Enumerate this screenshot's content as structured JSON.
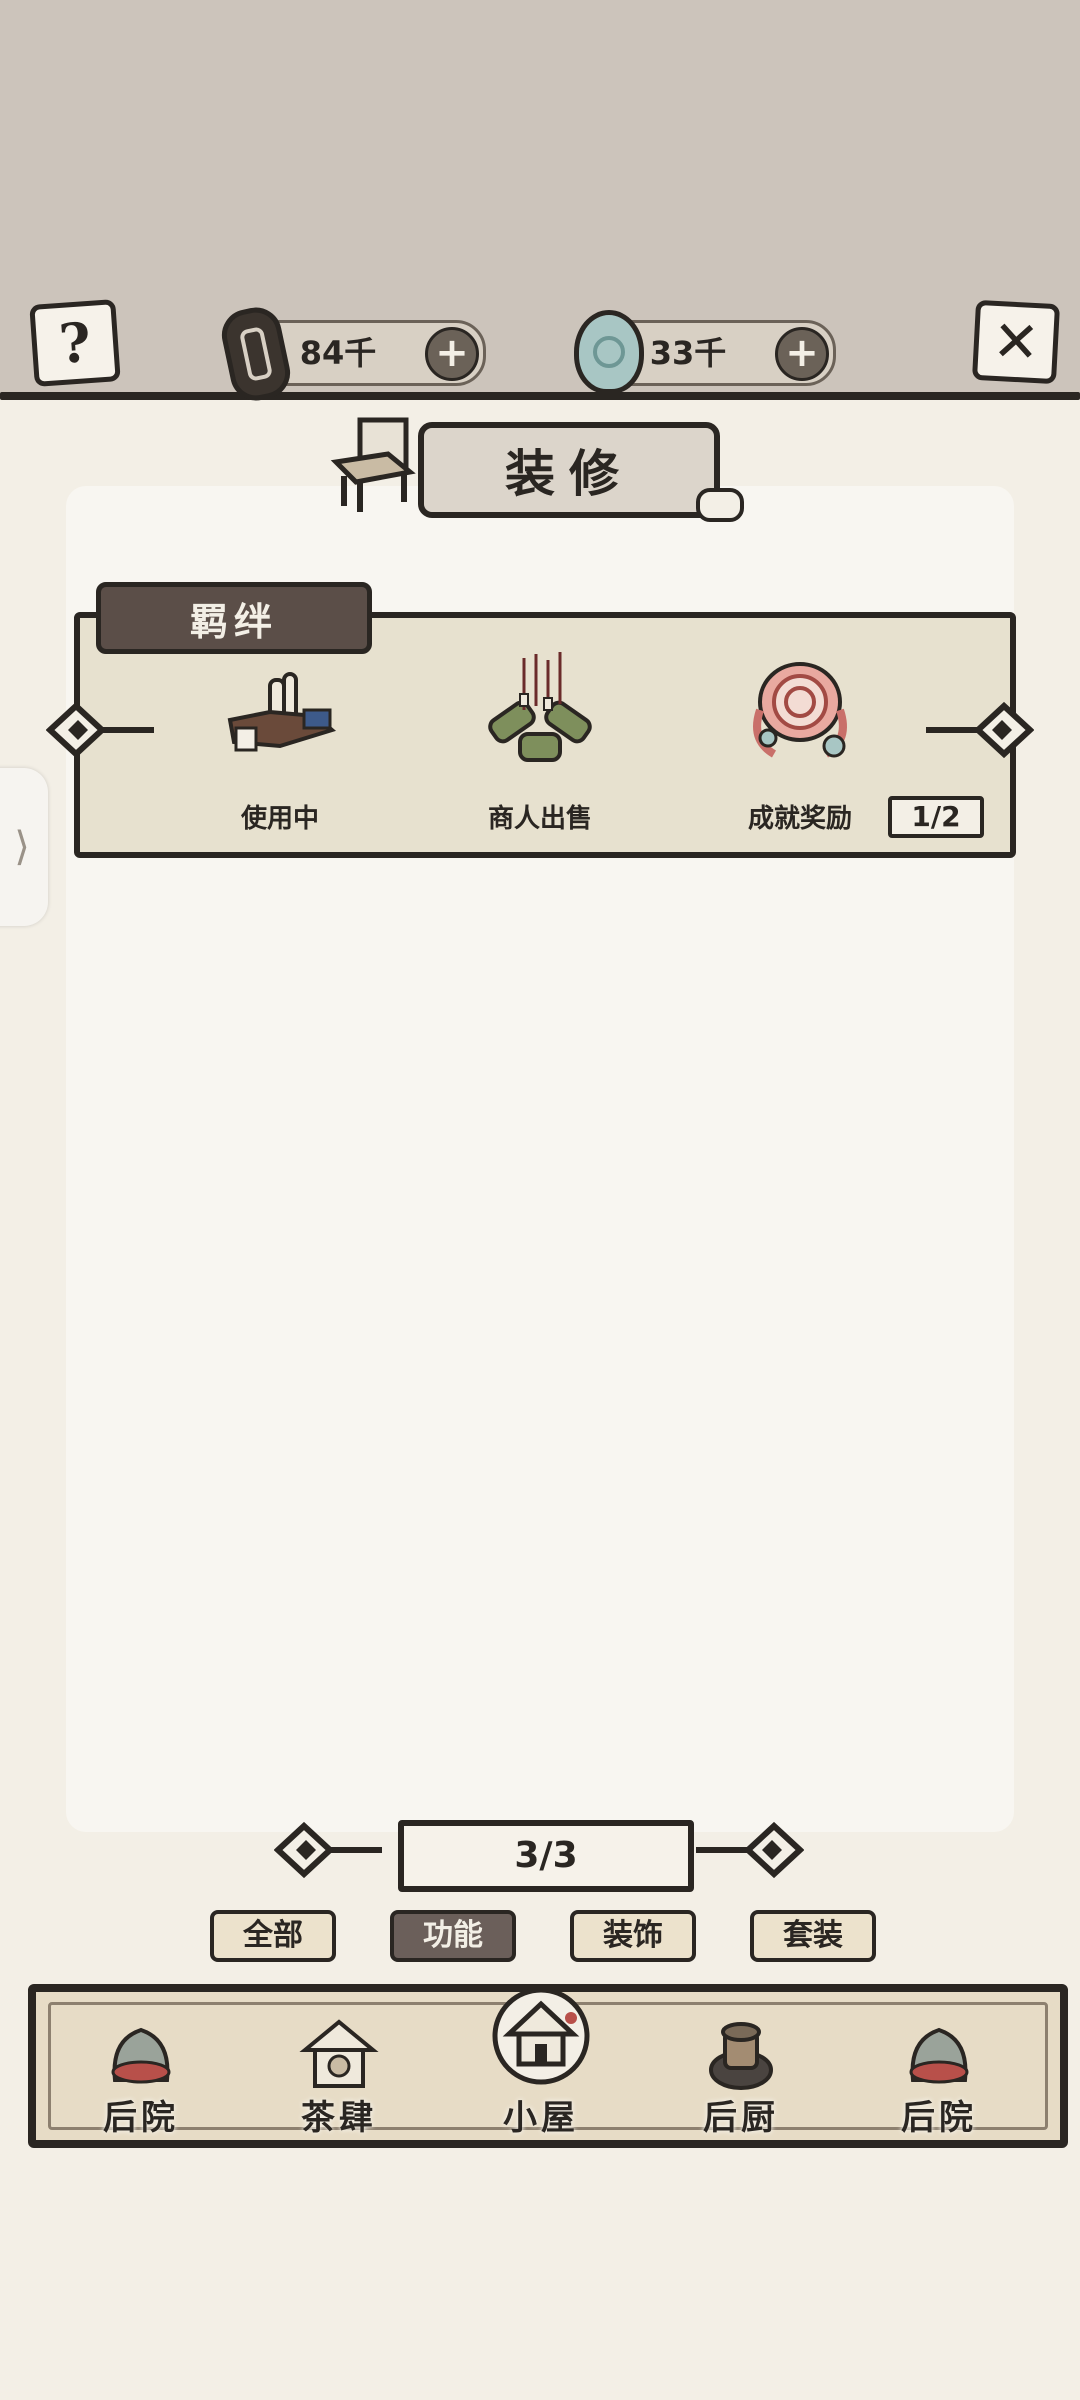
{
  "header": {
    "help_icon": "question-icon",
    "close_icon": "close-icon",
    "currencies": [
      {
        "icon": "coin-icon",
        "value": "84千",
        "plus": "+"
      },
      {
        "icon": "jade-icon",
        "value": "33千",
        "plus": "+"
      }
    ]
  },
  "title": "装修",
  "bond": {
    "tab_label": "羁绊",
    "items": [
      {
        "label": "使用中"
      },
      {
        "label": "商人出售"
      },
      {
        "label": "成就奖励"
      }
    ],
    "page": "1/2"
  },
  "pager": {
    "value": "3/3"
  },
  "filters": [
    "全部",
    "功能",
    "装饰",
    "套装"
  ],
  "nav": [
    "后院",
    "茶肆",
    "小屋",
    "后厨",
    "后院"
  ],
  "side_handle": "⟩"
}
